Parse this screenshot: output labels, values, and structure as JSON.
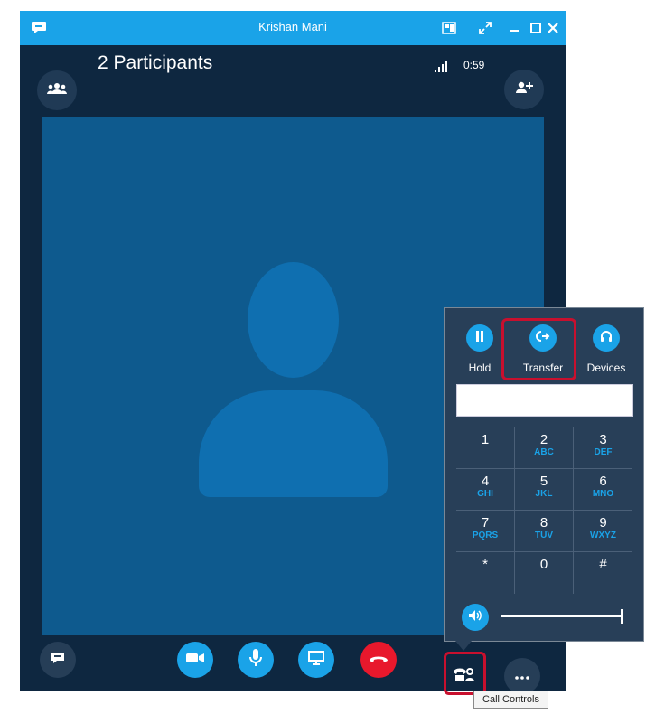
{
  "window": {
    "title": "Krishan Mani"
  },
  "header": {
    "participants_label": "2 Participants",
    "call_timer": "0:59"
  },
  "call_controls_popup": {
    "hold_label": "Hold",
    "transfer_label": "Transfer",
    "devices_label": "Devices",
    "number_input_value": "",
    "keypad": [
      {
        "num": "1",
        "letters": ""
      },
      {
        "num": "2",
        "letters": "ABC"
      },
      {
        "num": "3",
        "letters": "DEF"
      },
      {
        "num": "4",
        "letters": "GHI"
      },
      {
        "num": "5",
        "letters": "JKL"
      },
      {
        "num": "6",
        "letters": "MNO"
      },
      {
        "num": "7",
        "letters": "PQRS"
      },
      {
        "num": "8",
        "letters": "TUV"
      },
      {
        "num": "9",
        "letters": "WXYZ"
      },
      {
        "num": "*",
        "letters": ""
      },
      {
        "num": "0",
        "letters": ""
      },
      {
        "num": "#",
        "letters": ""
      }
    ],
    "volume_level": 1.0
  },
  "tooltip": {
    "text": "Call Controls"
  },
  "colors": {
    "accent": "#1aa3e8",
    "hangup": "#e8182c",
    "window_bg": "#0e2740",
    "highlight": "#c8102e"
  },
  "icons": {
    "app": "skype-chat-icon",
    "participants": "people-icon",
    "add_person": "add-person-icon",
    "signal": "signal-bars-icon",
    "chat": "chat-bubble-icon",
    "video": "video-camera-icon",
    "mic": "microphone-icon",
    "present": "monitor-icon",
    "hangup": "phone-hangup-icon",
    "call_controls": "dialpad-phone-icon",
    "more": "more-options-icon"
  }
}
